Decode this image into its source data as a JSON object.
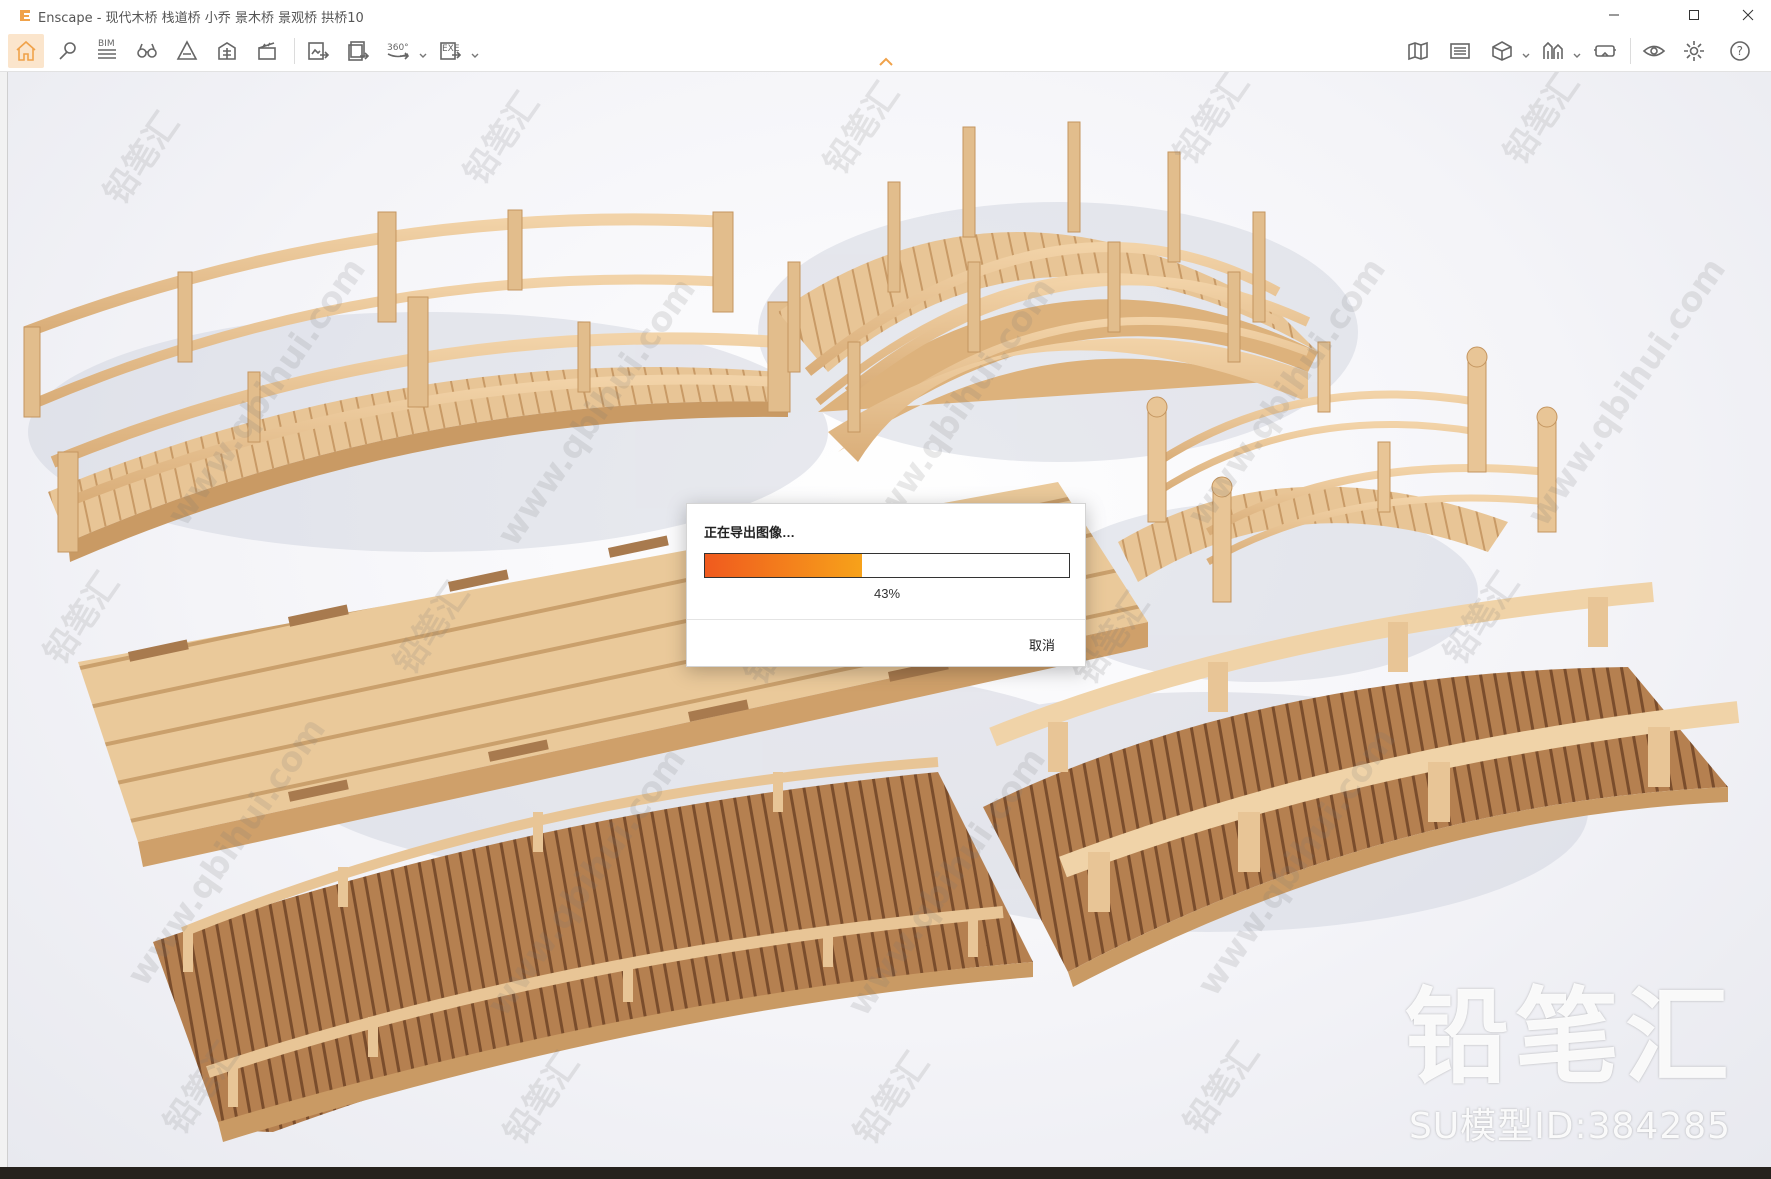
{
  "window": {
    "title": "Enscape - 现代木桥 栈道桥 小乔 景木桥 景观桥 拱桥10",
    "accent_color": "#f0a24a"
  },
  "toolbar": {
    "left_tools": [
      {
        "icon": "home-icon",
        "active": true
      },
      {
        "icon": "location-pin-icon"
      },
      {
        "icon": "bim-icon",
        "label": "BIM"
      },
      {
        "icon": "binoculars-icon"
      },
      {
        "icon": "ruler-icon"
      },
      {
        "icon": "asset-library-icon"
      },
      {
        "icon": "video-editor-icon"
      },
      {
        "icon": "screenshot-export-icon"
      },
      {
        "icon": "batch-export-icon"
      },
      {
        "icon": "panorama-360-icon",
        "label": "360°"
      },
      {
        "icon": "exe-export-icon",
        "label": "EXE"
      }
    ],
    "right_tools": [
      {
        "icon": "map-icon"
      },
      {
        "icon": "material-editor-icon"
      },
      {
        "icon": "cube-view-icon"
      },
      {
        "icon": "visual-settings-icon"
      },
      {
        "icon": "vr-headset-icon"
      },
      {
        "icon": "eye-icon"
      },
      {
        "icon": "gear-icon"
      },
      {
        "icon": "help-icon",
        "label": "?"
      }
    ]
  },
  "dialog": {
    "title": "正在导出图像…",
    "progress": 0.43,
    "progress_label": "43%",
    "cancel_label": "取消"
  },
  "watermark": {
    "text": "www.qbihui.com",
    "logo_text": "铅笔汇",
    "brand_name": "铅笔汇",
    "model_id": "SU模型ID:384285"
  }
}
